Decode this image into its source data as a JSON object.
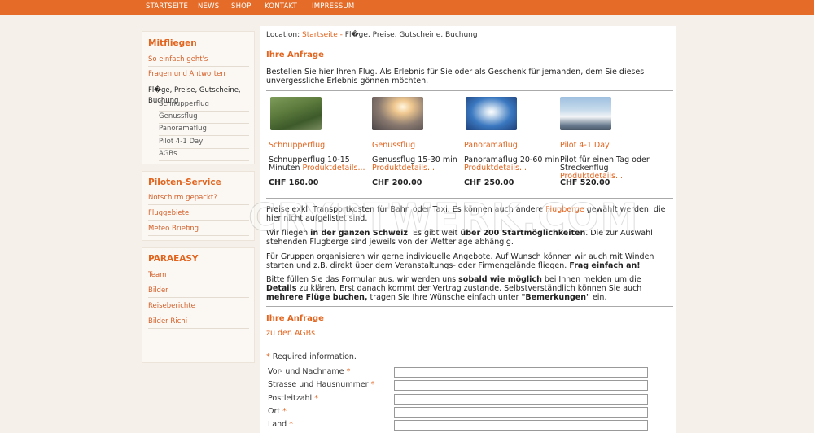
{
  "nav": [
    "STARTSEITE",
    "NEWS",
    "SHOP",
    "KONTAKT",
    "IMPRESSUM"
  ],
  "sidebar": {
    "mitfliegen": {
      "title": "Mitfliegen",
      "items": [
        "So einfach geht's",
        "Fragen und Antworten"
      ],
      "active": "Fl�ge, Preise, Gutscheine, Buchung",
      "sub": [
        "Schnupperflug",
        "Genussflug",
        "Panoramaflug",
        "Pilot 4-1 Day",
        "AGBs"
      ]
    },
    "piloten": {
      "title": "Piloten-Service",
      "items": [
        "Notschirm gepackt?",
        "Fluggebiete",
        "Meteo Briefing"
      ]
    },
    "paraeasy": {
      "title": "PARAEASY",
      "items": [
        "Team",
        "Bilder",
        "Reiseberichte",
        "Bilder Richi"
      ]
    }
  },
  "breadcrumb": {
    "prefix": "Location:",
    "home": "Startseite",
    "sep": "-",
    "current": "Fl�ge, Preise, Gutscheine, Buchung"
  },
  "main": {
    "heading": "Ihre Anfrage",
    "intro": "Bestellen Sie hier Ihren Flug. Als Erlebnis für Sie oder als Geschenk für jemanden, dem Sie dieses unvergessliche Erlebnis gönnen möchten.",
    "products": [
      {
        "name": "Schnupperflug",
        "desc": "Schnupperflug 10-15 Minuten",
        "details": "Produktdetails...",
        "price": "CHF 160.00",
        "img": "landscape"
      },
      {
        "name": "Genussflug",
        "desc": "Genussflug 15-30 min",
        "details": "Produktdetails...",
        "price": "CHF 200.00",
        "img": "sunset"
      },
      {
        "name": "Panoramaflug",
        "desc": "Panoramaflug 20-60 min",
        "details": "Produktdetails...",
        "price": "CHF 250.00",
        "img": "sky"
      },
      {
        "name": "Pilot 4-1 Day",
        "desc": "Pilot für einen Tag oder Streckenflug",
        "details": "Produktdetails...",
        "price": "CHF 520.00",
        "img": "mountains"
      }
    ],
    "p1_a": "Preise exkl. Transportkosten für Bahn oder Taxi. Es können auch andere ",
    "p1_link": "Flugberge",
    "p1_b": " gewählt werden, die hier nicht aufgelistet sind.",
    "p2_a": "Wir fliegen ",
    "p2_b1": "in der ganzen Schweiz",
    "p2_c": ". Es gibt weit ",
    "p2_b2": "über 200 Startmöglichkeiten",
    "p2_d": ". Die zur Auswahl stehenden Flugberge sind jeweils von der Wetterlage abhängig.",
    "p3_a": "Für Gruppen organisieren wir gerne individuelle Angebote. Auf Wunsch können wir auch mit Winden starten und z.B. direkt über dem Veranstaltungs- oder Firmengelände fliegen. ",
    "p3_b": "Frag einfach an!",
    "p4_a": "Bitte füllen Sie das Formular aus, wir werden uns ",
    "p4_b1": "sobald wie möglich",
    "p4_c": " bei Ihnen melden um die ",
    "p4_b2": "Details",
    "p4_d": " zu klären. Erst danach kommt der Vertrag zustande. Selbstverständlich können Sie auch ",
    "p4_b3": "mehrere Flüge buchen,",
    "p4_e": " tragen Sie Ihre Wünsche einfach unter ",
    "p4_b4": "\"Bemerkungen\"",
    "p4_f": " ein.",
    "heading2": "Ihre Anfrage",
    "agbs_link": "zu den AGBs"
  },
  "form": {
    "required_star": "*",
    "required_note": "Required information.",
    "fields": [
      {
        "label": "Vor- und Nachname",
        "value": ""
      },
      {
        "label": "Strasse und Hausnummer",
        "value": ""
      },
      {
        "label": "Postleitzahl",
        "value": ""
      },
      {
        "label": "Ort",
        "value": ""
      },
      {
        "label": "Land",
        "value": ""
      }
    ]
  },
  "watermark": "CRYPTWERK.COM",
  "colors": {
    "accent": "#e46c28",
    "link": "#e2651f",
    "bg": "#f5f1ea"
  }
}
